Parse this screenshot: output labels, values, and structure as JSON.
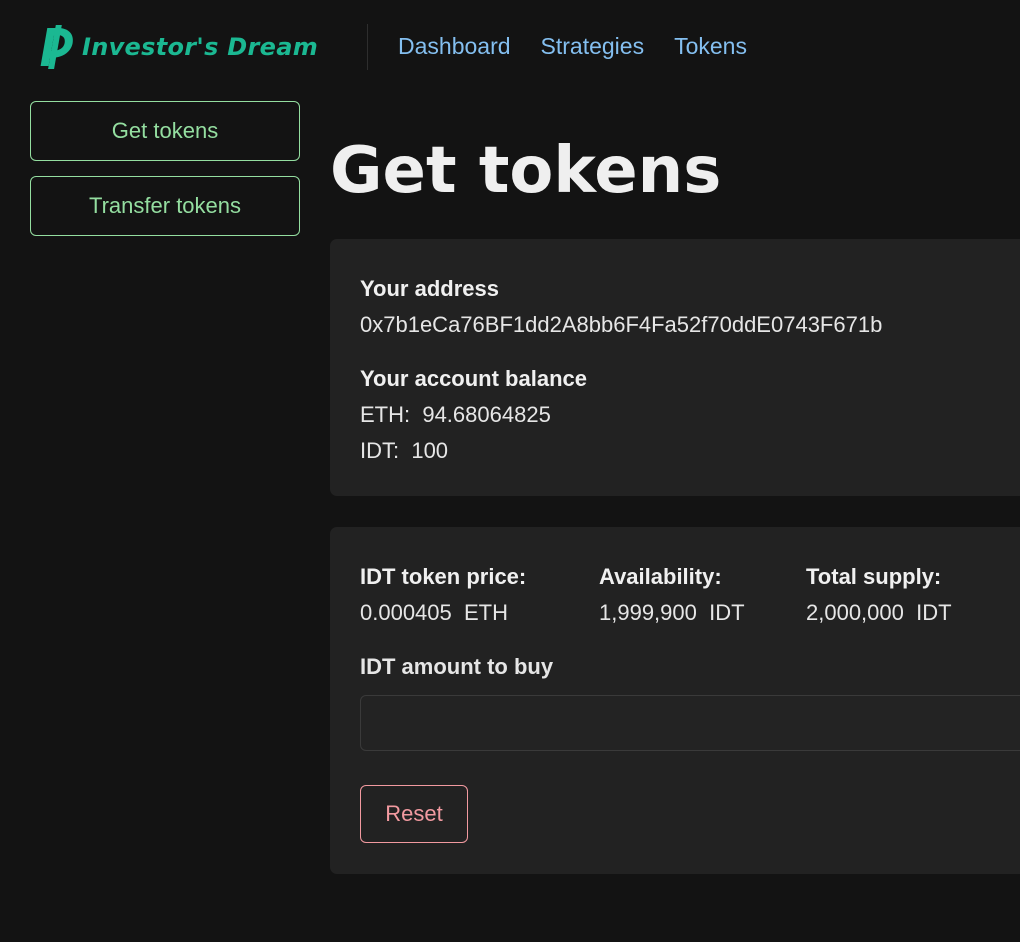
{
  "brand": {
    "name": "Investor's Dream",
    "logo_icon": "idt-coin-icon",
    "color": "#1bb892"
  },
  "nav": {
    "items": [
      {
        "label": "Dashboard"
      },
      {
        "label": "Strategies"
      },
      {
        "label": "Tokens"
      }
    ],
    "color": "#84bff0"
  },
  "sidebar": {
    "items": [
      {
        "label": "Get tokens"
      },
      {
        "label": "Transfer tokens"
      }
    ],
    "accent": "#94dea0"
  },
  "page": {
    "title": "Get tokens"
  },
  "account": {
    "address_label": "Your address",
    "address": "0x7b1eCa76BF1dd2A8bb6F4Fa52f70ddE0743F671b",
    "balance_label": "Your account balance",
    "eth_line": "ETH:  94.68064825",
    "idt_line": "IDT:  100"
  },
  "token": {
    "price_label": "IDT token price:",
    "price_value": "0.000405  ETH",
    "availability_label": "Availability:",
    "availability_value": "1,999,900  IDT",
    "supply_label": "Total supply:",
    "supply_value": "2,000,000  IDT",
    "amount_label": "IDT amount to buy",
    "amount_value": "",
    "amount_placeholder": "",
    "reset_label": "Reset",
    "reset_color": "#f29aa0"
  },
  "colors": {
    "background": "#131313",
    "card": "#222222"
  }
}
